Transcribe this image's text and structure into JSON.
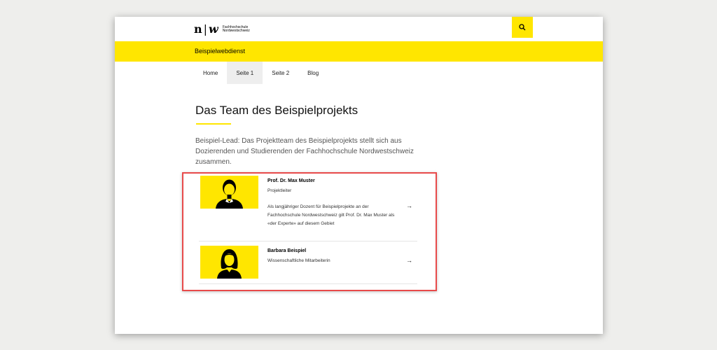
{
  "header": {
    "logo_mark_n": "n",
    "logo_mark_sep": "|",
    "logo_mark_w": "w",
    "logo_line1": "Fachhochschule",
    "logo_line2": "Nordwestschweiz",
    "search_icon": "search-icon"
  },
  "service": {
    "name": "Beispielwebdienst"
  },
  "nav": {
    "items": [
      {
        "label": "Home"
      },
      {
        "label": "Seite 1"
      },
      {
        "label": "Seite 2"
      },
      {
        "label": "Blog"
      }
    ],
    "active": "Seite 1"
  },
  "main": {
    "title": "Das Team des Beispielprojekts",
    "lead": "Beispiel-Lead: Das Projektteam des Beispielprojekts stellt sich aus Dozierenden und Studierenden der Fachhochschule Nordwestschweiz zusammen."
  },
  "team": [
    {
      "name": "Prof. Dr. Max Muster",
      "role": "Projektleiter",
      "description": "Als langjähriger Dozent für Beispielprojekte an der Fachhochschule Nordwestschweiz gilt Prof. Dr. Max Muster als «der Experte» auf diesem Gebiet",
      "arrow": "→",
      "avatar_icon": "male-avatar-icon"
    },
    {
      "name": "Barbara Beispiel",
      "role": "Wissenschaftliche Mitarbeiterin",
      "arrow": "→",
      "avatar_icon": "female-avatar-icon"
    }
  ],
  "colors": {
    "accent": "#ffe600",
    "highlight_border": "#e84a4a",
    "background": "#eeeeec"
  }
}
